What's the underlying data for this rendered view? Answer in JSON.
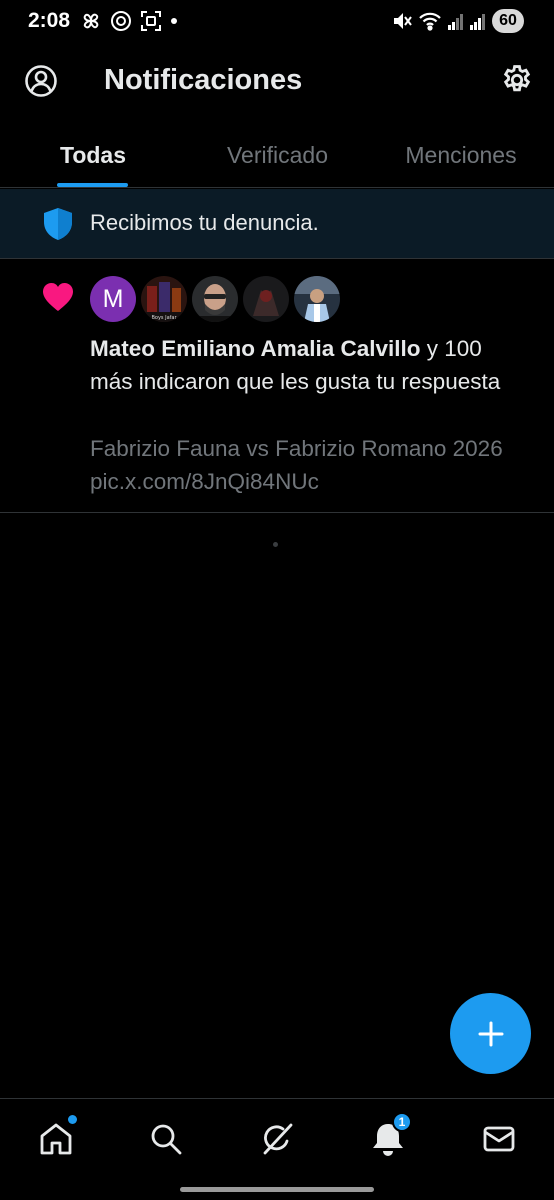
{
  "status_bar": {
    "time": "2:08",
    "battery": "60",
    "left_icons": [
      "pinwheel-icon",
      "threads-icon",
      "screenshot-icon",
      "dot-icon"
    ],
    "right_icons": [
      "mute-icon",
      "wifi-icon",
      "signal-icon",
      "signal-icon",
      "battery-icon"
    ]
  },
  "header": {
    "title": "Notificaciones",
    "left_icon": "profile-icon",
    "right_icon": "settings-icon"
  },
  "tabs": [
    {
      "label": "Todas",
      "active": true
    },
    {
      "label": "Verificado",
      "active": false
    },
    {
      "label": "Menciones",
      "active": false
    }
  ],
  "banner": {
    "icon": "shield-icon",
    "text": "Recibimos tu denuncia."
  },
  "notification": {
    "icon": "heart-icon",
    "avatar_letter": "M",
    "avatar_image_text": "Boys Jafar",
    "actor_name": "Mateo Emiliano Amalia Calvillo",
    "action_text": " y 100 más indicaron que les gusta tu respuesta",
    "quoted_text": "Fabrizio Fauna vs Fabrizio Romano 2026 pic.x.com/8JnQi84NUc"
  },
  "fab": {
    "icon": "plus-icon"
  },
  "bottom_nav": {
    "items": [
      "home-icon",
      "search-icon",
      "grok-icon",
      "bell-icon",
      "mail-icon"
    ],
    "notifications_badge": "1"
  },
  "colors": {
    "accent": "#1d9bf0",
    "like": "#f91880",
    "banner_bg": "#0b1b26",
    "muted_text": "#71767b",
    "divider": "#2f3336"
  }
}
